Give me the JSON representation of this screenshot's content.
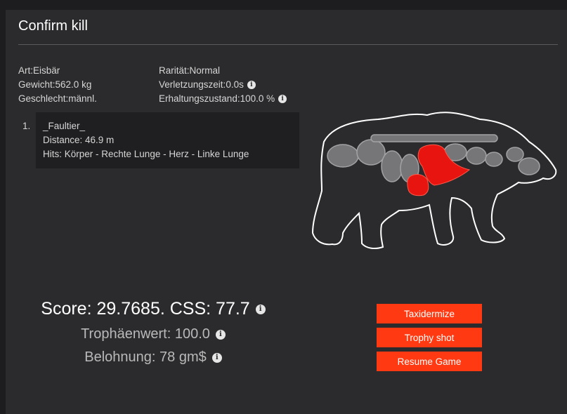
{
  "dialog": {
    "title": "Confirm kill"
  },
  "stats": {
    "col1": [
      {
        "label": "Art: ",
        "value": "Eisbär"
      },
      {
        "label": "Gewicht: ",
        "value": "562.0 kg"
      },
      {
        "label": "Geschlecht: ",
        "value": "männl."
      }
    ],
    "col2": [
      {
        "label": "Rarität: ",
        "value": "Normal"
      },
      {
        "label": "Verletzungszeit: ",
        "value": "0.0s"
      },
      {
        "label": "Erhaltungszustand: ",
        "value": "100.0 %"
      }
    ]
  },
  "shots": [
    {
      "index": "1.",
      "shooter": "_Faultier_",
      "distance": "Distance: 46.9 m",
      "hits": "Hits: Körper - Rechte Lunge - Herz - Linke Lunge"
    }
  ],
  "score": {
    "main": "Score: 29.7685. CSS: 77.7",
    "trophy": "Trophäenwert: 100.0",
    "reward": "Belohnung: 78 gm$"
  },
  "buttons": {
    "taxidermize": "Taxidermize",
    "trophy_shot": "Trophy shot",
    "resume": "Resume Game"
  },
  "colors": {
    "accent": "#ff3a12",
    "hit_organ": "#e8140f",
    "panel": "#2b2b2d"
  },
  "icons": {
    "info": "info-icon"
  }
}
